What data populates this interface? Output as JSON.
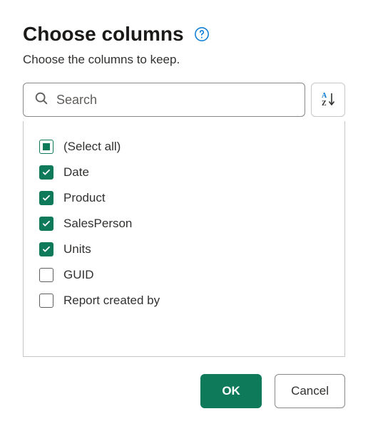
{
  "header": {
    "title": "Choose columns",
    "subtitle": "Choose the columns to keep."
  },
  "search": {
    "placeholder": "Search",
    "value": ""
  },
  "select_all_label": "(Select all)",
  "columns": [
    {
      "label": "Date",
      "checked": true
    },
    {
      "label": "Product",
      "checked": true
    },
    {
      "label": "SalesPerson",
      "checked": true
    },
    {
      "label": "Units",
      "checked": true
    },
    {
      "label": "GUID",
      "checked": false
    },
    {
      "label": "Report created by",
      "checked": false
    }
  ],
  "buttons": {
    "ok": "OK",
    "cancel": "Cancel"
  },
  "colors": {
    "accent": "#0f7a5a",
    "help": "#0078d4"
  }
}
